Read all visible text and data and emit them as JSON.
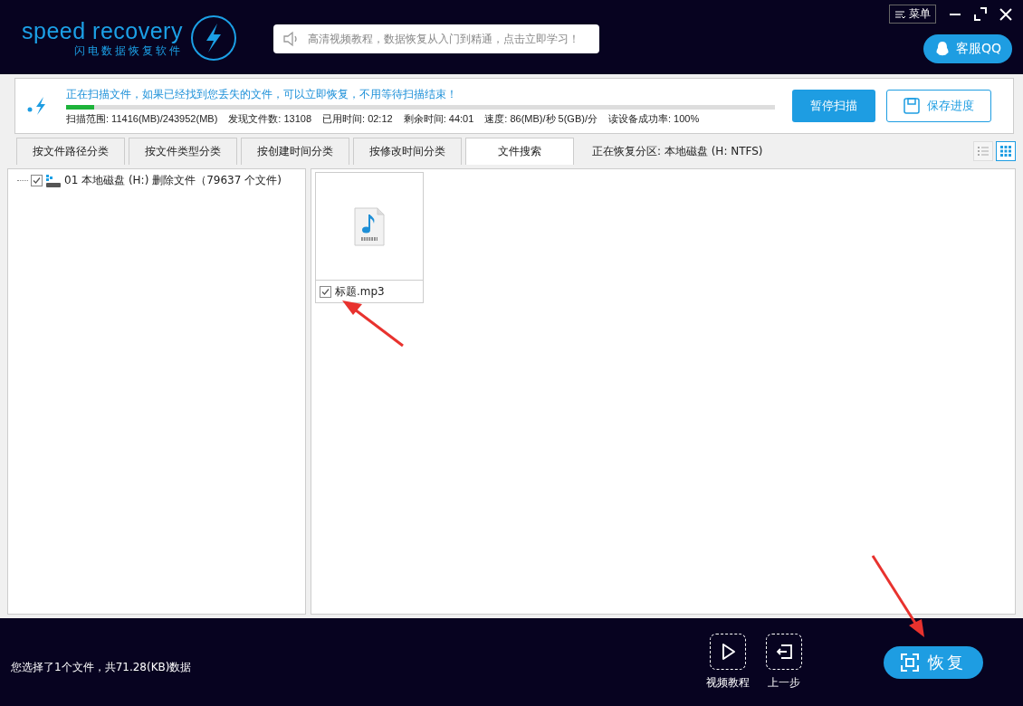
{
  "app": {
    "logo_text": "speed recovery",
    "logo_subtitle": "闪电数据恢复软件",
    "notice": "高清视频教程，数据恢复从入门到精通，点击立即学习！",
    "menu_button": "菜单",
    "support_button": "客服QQ"
  },
  "scan": {
    "status": "正在扫描文件，如果已经找到您丢失的文件，可以立即恢复，不用等待扫描结束！",
    "level": 0.04,
    "stats": [
      "扫描范围: 11416(MB)/243952(MB)",
      "发现文件数: 13108",
      "已用时间: 02:12",
      "剩余时间: 44:01",
      "速度: 86(MB)/秒 5(GB)/分",
      "读设备成功率: 100%"
    ],
    "buttons": [
      {
        "label": "暂停扫描",
        "kind": "primary"
      },
      {
        "label": "保存进度",
        "kind": "save"
      }
    ]
  },
  "tabs": [
    {
      "label": "按文件路径分类",
      "selected": false
    },
    {
      "label": "按文件类型分类",
      "selected": false
    },
    {
      "label": "按创建时间分类",
      "selected": false
    },
    {
      "label": "按修改时间分类",
      "selected": false
    },
    {
      "label": "文件搜索",
      "selected": true
    }
  ],
  "partition": "正在恢复分区: 本地磁盘 (H: NTFS)",
  "views": [
    {
      "kind": "list",
      "selected": false
    },
    {
      "kind": "grid",
      "selected": true
    }
  ],
  "tree": [
    {
      "label": "01 本地磁盘 (H:) 删除文件（79637 个文件)",
      "checked": true
    }
  ],
  "files": [
    {
      "name": "标题.mp3",
      "checked": true
    }
  ],
  "footer": {
    "selection": "您选择了1个文件，共71.28(KB)数据",
    "actions": [
      {
        "label": "视频教程",
        "kind": "play"
      },
      {
        "label": "上一步",
        "kind": "back"
      }
    ],
    "recover_button": "恢复"
  }
}
